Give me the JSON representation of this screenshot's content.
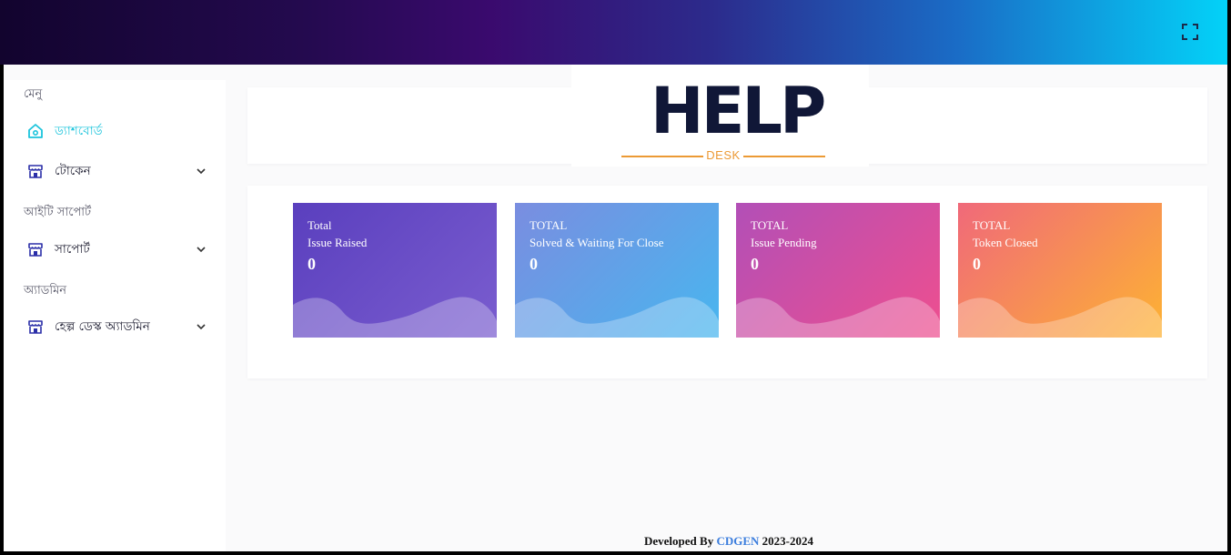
{
  "header": {
    "fullscreen_icon": "fullscreen-icon"
  },
  "sidebar": {
    "sections": [
      {
        "title": "মেনু",
        "items": [
          {
            "label": "ড্যাশবোর্ড",
            "icon": "home-icon",
            "active": true,
            "has_submenu": false
          },
          {
            "label": "টোকেন",
            "icon": "store-icon",
            "active": false,
            "has_submenu": true
          }
        ]
      },
      {
        "title": "আইটি সাপোর্ট",
        "items": [
          {
            "label": "সাপোর্ট",
            "icon": "store-icon",
            "active": false,
            "has_submenu": true
          }
        ]
      },
      {
        "title": "অ্যাডমিন",
        "items": [
          {
            "label": "হেল্প ডেস্ক অ্যাডমিন",
            "icon": "store-icon",
            "active": false,
            "has_submenu": true
          }
        ]
      }
    ]
  },
  "logo": {
    "title": "HELP",
    "subtitle": "DESK"
  },
  "stats": [
    {
      "top": "Total",
      "label": "Issue Raised",
      "value": "0"
    },
    {
      "top": "TOTAL",
      "label": "Solved & Waiting For Close",
      "value": "0"
    },
    {
      "top": "TOTAL",
      "label": "Issue Pending",
      "value": "0"
    },
    {
      "top": "TOTAL",
      "label": "Token Closed",
      "value": "0"
    }
  ],
  "footer": {
    "prefix": "Developed By",
    "brand": "CDGEN",
    "years": "2023-2024"
  },
  "colors": {
    "active_menu": "#1cc4dc",
    "icon_blue": "#2b2fa8",
    "logo_dark": "#101737",
    "logo_orange": "#ec9a35",
    "footer_brand": "#3b7ddd"
  }
}
